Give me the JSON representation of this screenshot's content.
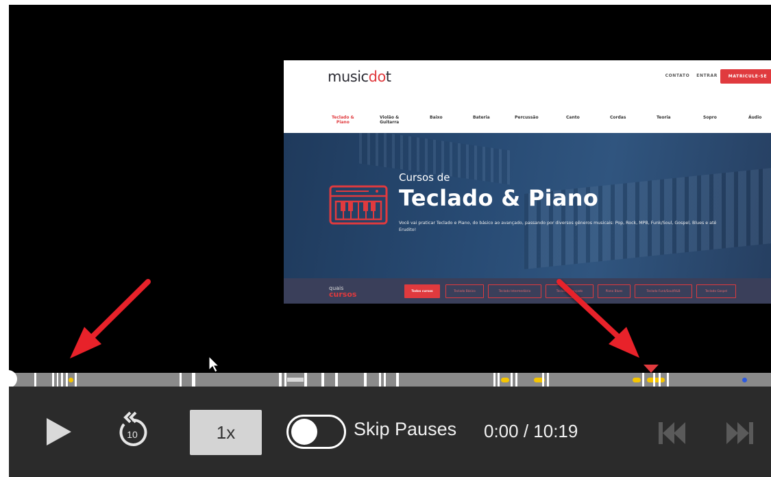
{
  "website": {
    "logo": {
      "text_before": "music",
      "dot_text": "d",
      "accent_o": "o",
      "text_after": "t"
    },
    "top_links": [
      "CONTATO",
      "ENTRAR"
    ],
    "cta_label": "MATRICULE-SE",
    "nav_items": [
      {
        "line1": "Teclado &",
        "line2": "Piano"
      },
      {
        "line1": "Violão &",
        "line2": "Guitarra"
      },
      {
        "line1": "Baixo",
        "line2": ""
      },
      {
        "line1": "Bateria",
        "line2": ""
      },
      {
        "line1": "Percussão",
        "line2": ""
      },
      {
        "line1": "Canto",
        "line2": ""
      },
      {
        "line1": "Cordas",
        "line2": ""
      },
      {
        "line1": "Teoria",
        "line2": ""
      },
      {
        "line1": "Sopro",
        "line2": ""
      },
      {
        "line1": "Áudio",
        "line2": ""
      }
    ],
    "hero": {
      "subtitle": "Cursos de",
      "title": "Teclado & Piano",
      "description": "Você vai praticar Teclado e Piano, do básico ao avançado, passando por diversos gêneros musicais: Pop, Rock, MPB, Funk/Soul, Gospel, Blues e até Erudito!"
    },
    "filter": {
      "label_line1": "quais",
      "label_line2": "cursos",
      "buttons": [
        "Todos cursos",
        "Teclado Básico",
        "Teclado Intermediário",
        "Teclado Avançado",
        "Piano Blues",
        "Teclado Funk/Soul/R&B",
        "Teclado Gospel"
      ]
    },
    "accent_color": "#e03a3e"
  },
  "player": {
    "speed_label": "1x",
    "rewind_seconds": "10",
    "skip_pauses_label": "Skip Pauses",
    "skip_pauses_enabled": false,
    "time_readout": "0:00 / 10:19",
    "progress_fraction": 0.0,
    "icons": {
      "play": "play-icon",
      "rewind": "rewind-10-icon",
      "previous": "skip-previous-icon",
      "next": "skip-next-icon"
    }
  }
}
